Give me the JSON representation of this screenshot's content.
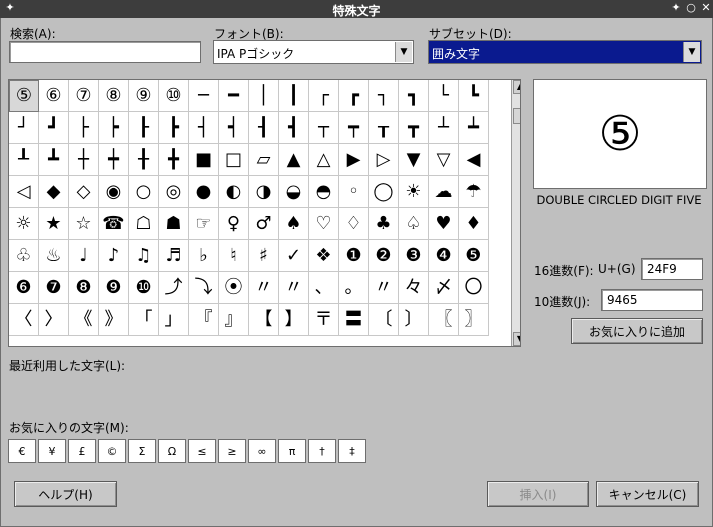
{
  "window": {
    "title": "特殊文字",
    "controls": [
      "✦",
      "○",
      "✕"
    ]
  },
  "search": {
    "label": "検索(A):",
    "value": ""
  },
  "font": {
    "label": "フォント(B):",
    "value": "IPA Pゴシック"
  },
  "subset": {
    "label": "サブセット(D):",
    "value": "囲み文字"
  },
  "grid": {
    "chars": [
      "⑤",
      "⑥",
      "⑦",
      "⑧",
      "⑨",
      "⑩",
      "─",
      "━",
      "│",
      "┃",
      "┌",
      "┏",
      "┐",
      "┓",
      "└",
      "┗",
      "┘",
      "┛",
      "├",
      "┝",
      "┠",
      "┣",
      "┤",
      "┥",
      "┨",
      "┫",
      "┬",
      "┯",
      "┰",
      "┳",
      "┴",
      "┷",
      "┸",
      "┻",
      "┼",
      "┿",
      "╂",
      "╋",
      "■",
      "□",
      "▱",
      "▲",
      "△",
      "▶",
      "▷",
      "▼",
      "▽",
      "◀",
      "◁",
      "◆",
      "◇",
      "◉",
      "○",
      "◎",
      "●",
      "◐",
      "◑",
      "◒",
      "◓",
      "◦",
      "◯",
      "☀",
      "☁",
      "☂",
      "☼",
      "★",
      "☆",
      "☎",
      "☖",
      "☗",
      "☞",
      "♀",
      "♂",
      "♠",
      "♡",
      "♢",
      "♣",
      "♤",
      "♥",
      "♦",
      "♧",
      "♨",
      "♩",
      "♪",
      "♫",
      "♬",
      "♭",
      "♮",
      "♯",
      "✓",
      "❖",
      "❶",
      "❷",
      "❸",
      "❹",
      "❺",
      "❻",
      "❼",
      "❽",
      "❾",
      "❿",
      "⤴",
      "⤵",
      "⦿",
      "〃",
      "〃",
      "、",
      "。",
      "〃",
      "々",
      "〆",
      "〇",
      "〈",
      "〉",
      "《",
      "》",
      "「",
      "」",
      "『",
      "』",
      "【",
      "】",
      "〒",
      "〓",
      "〔",
      "〕",
      "〖",
      "〗"
    ],
    "selected_index": 0
  },
  "preview": {
    "char": "⑤",
    "name": "DOUBLE CIRCLED DIGIT FIVE"
  },
  "hex": {
    "label": "16進数(F):",
    "prefix": "U+(G)",
    "value": "24F9"
  },
  "dec": {
    "label": "10進数(J):",
    "value": "9465"
  },
  "add_favorite_button": "お気に入りに追加",
  "recent": {
    "label": "最近利用した文字(L):"
  },
  "favorites": {
    "label": "お気に入りの文字(M):",
    "chars": [
      "€",
      "¥",
      "£",
      "©",
      "Σ",
      "Ω",
      "≤",
      "≥",
      "∞",
      "π",
      "†",
      "‡"
    ]
  },
  "buttons": {
    "help": "ヘルプ(H)",
    "insert": "挿入(I)",
    "cancel": "キャンセル(C)"
  }
}
